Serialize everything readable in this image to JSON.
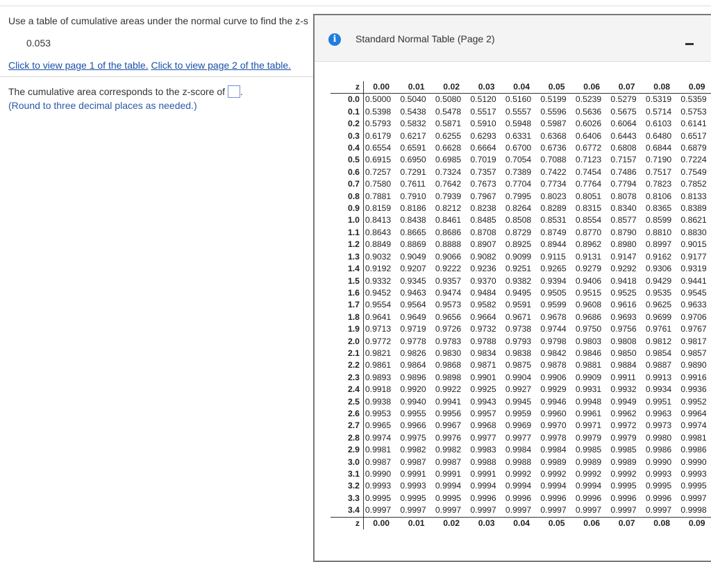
{
  "question": {
    "text": "Use a table of cumulative areas under the normal curve to find the z-s",
    "value": "0.053",
    "link1": "Click to view page 1 of the table.",
    "link2": "Click to view page 2 of the table.",
    "answer_prefix": "The cumulative area corresponds to the z-score of",
    "answer_suffix": ".",
    "hint": "(Round to three decimal places as needed.)"
  },
  "popup": {
    "title": "Standard Normal Table (Page 2)",
    "icon": "info-icon",
    "minimize_icon": "minimize-icon"
  },
  "table": {
    "z_label": "z",
    "columns": [
      "0.00",
      "0.01",
      "0.02",
      "0.03",
      "0.04",
      "0.05",
      "0.06",
      "0.07",
      "0.08",
      "0.09"
    ],
    "rows": [
      {
        "z": "0.0",
        "values": [
          "0.5000",
          "0.5040",
          "0.5080",
          "0.5120",
          "0.5160",
          "0.5199",
          "0.5239",
          "0.5279",
          "0.5319",
          "0.5359"
        ]
      },
      {
        "z": "0.1",
        "values": [
          "0.5398",
          "0.5438",
          "0.5478",
          "0.5517",
          "0.5557",
          "0.5596",
          "0.5636",
          "0.5675",
          "0.5714",
          "0.5753"
        ]
      },
      {
        "z": "0.2",
        "values": [
          "0.5793",
          "0.5832",
          "0.5871",
          "0.5910",
          "0.5948",
          "0.5987",
          "0.6026",
          "0.6064",
          "0.6103",
          "0.6141"
        ]
      },
      {
        "z": "0.3",
        "values": [
          "0.6179",
          "0.6217",
          "0.6255",
          "0.6293",
          "0.6331",
          "0.6368",
          "0.6406",
          "0.6443",
          "0.6480",
          "0.6517"
        ]
      },
      {
        "z": "0.4",
        "values": [
          "0.6554",
          "0.6591",
          "0.6628",
          "0.6664",
          "0.6700",
          "0.6736",
          "0.6772",
          "0.6808",
          "0.6844",
          "0.6879"
        ]
      },
      {
        "z": "0.5",
        "values": [
          "0.6915",
          "0.6950",
          "0.6985",
          "0.7019",
          "0.7054",
          "0.7088",
          "0.7123",
          "0.7157",
          "0.7190",
          "0.7224"
        ]
      },
      {
        "z": "0.6",
        "values": [
          "0.7257",
          "0.7291",
          "0.7324",
          "0.7357",
          "0.7389",
          "0.7422",
          "0.7454",
          "0.7486",
          "0.7517",
          "0.7549"
        ]
      },
      {
        "z": "0.7",
        "values": [
          "0.7580",
          "0.7611",
          "0.7642",
          "0.7673",
          "0.7704",
          "0.7734",
          "0.7764",
          "0.7794",
          "0.7823",
          "0.7852"
        ]
      },
      {
        "z": "0.8",
        "values": [
          "0.7881",
          "0.7910",
          "0.7939",
          "0.7967",
          "0.7995",
          "0.8023",
          "0.8051",
          "0.8078",
          "0.8106",
          "0.8133"
        ]
      },
      {
        "z": "0.9",
        "values": [
          "0.8159",
          "0.8186",
          "0.8212",
          "0.8238",
          "0.8264",
          "0.8289",
          "0.8315",
          "0.8340",
          "0.8365",
          "0.8389"
        ]
      },
      {
        "z": "1.0",
        "values": [
          "0.8413",
          "0.8438",
          "0.8461",
          "0.8485",
          "0.8508",
          "0.8531",
          "0.8554",
          "0.8577",
          "0.8599",
          "0.8621"
        ]
      },
      {
        "z": "1.1",
        "values": [
          "0.8643",
          "0.8665",
          "0.8686",
          "0.8708",
          "0.8729",
          "0.8749",
          "0.8770",
          "0.8790",
          "0.8810",
          "0.8830"
        ]
      },
      {
        "z": "1.2",
        "values": [
          "0.8849",
          "0.8869",
          "0.8888",
          "0.8907",
          "0.8925",
          "0.8944",
          "0.8962",
          "0.8980",
          "0.8997",
          "0.9015"
        ]
      },
      {
        "z": "1.3",
        "values": [
          "0.9032",
          "0.9049",
          "0.9066",
          "0.9082",
          "0.9099",
          "0.9115",
          "0.9131",
          "0.9147",
          "0.9162",
          "0.9177"
        ]
      },
      {
        "z": "1.4",
        "values": [
          "0.9192",
          "0.9207",
          "0.9222",
          "0.9236",
          "0.9251",
          "0.9265",
          "0.9279",
          "0.9292",
          "0.9306",
          "0.9319"
        ]
      },
      {
        "z": "1.5",
        "values": [
          "0.9332",
          "0.9345",
          "0.9357",
          "0.9370",
          "0.9382",
          "0.9394",
          "0.9406",
          "0.9418",
          "0.9429",
          "0.9441"
        ]
      },
      {
        "z": "1.6",
        "values": [
          "0.9452",
          "0.9463",
          "0.9474",
          "0.9484",
          "0.9495",
          "0.9505",
          "0.9515",
          "0.9525",
          "0.9535",
          "0.9545"
        ]
      },
      {
        "z": "1.7",
        "values": [
          "0.9554",
          "0.9564",
          "0.9573",
          "0.9582",
          "0.9591",
          "0.9599",
          "0.9608",
          "0.9616",
          "0.9625",
          "0.9633"
        ]
      },
      {
        "z": "1.8",
        "values": [
          "0.9641",
          "0.9649",
          "0.9656",
          "0.9664",
          "0.9671",
          "0.9678",
          "0.9686",
          "0.9693",
          "0.9699",
          "0.9706"
        ]
      },
      {
        "z": "1.9",
        "values": [
          "0.9713",
          "0.9719",
          "0.9726",
          "0.9732",
          "0.9738",
          "0.9744",
          "0.9750",
          "0.9756",
          "0.9761",
          "0.9767"
        ]
      },
      {
        "z": "2.0",
        "values": [
          "0.9772",
          "0.9778",
          "0.9783",
          "0.9788",
          "0.9793",
          "0.9798",
          "0.9803",
          "0.9808",
          "0.9812",
          "0.9817"
        ]
      },
      {
        "z": "2.1",
        "values": [
          "0.9821",
          "0.9826",
          "0.9830",
          "0.9834",
          "0.9838",
          "0.9842",
          "0.9846",
          "0.9850",
          "0.9854",
          "0.9857"
        ]
      },
      {
        "z": "2.2",
        "values": [
          "0.9861",
          "0.9864",
          "0.9868",
          "0.9871",
          "0.9875",
          "0.9878",
          "0.9881",
          "0.9884",
          "0.9887",
          "0.9890"
        ]
      },
      {
        "z": "2.3",
        "values": [
          "0.9893",
          "0.9896",
          "0.9898",
          "0.9901",
          "0.9904",
          "0.9906",
          "0.9909",
          "0.9911",
          "0.9913",
          "0.9916"
        ]
      },
      {
        "z": "2.4",
        "values": [
          "0.9918",
          "0.9920",
          "0.9922",
          "0.9925",
          "0.9927",
          "0.9929",
          "0.9931",
          "0.9932",
          "0.9934",
          "0.9936"
        ]
      },
      {
        "z": "2.5",
        "values": [
          "0.9938",
          "0.9940",
          "0.9941",
          "0.9943",
          "0.9945",
          "0.9946",
          "0.9948",
          "0.9949",
          "0.9951",
          "0.9952"
        ]
      },
      {
        "z": "2.6",
        "values": [
          "0.9953",
          "0.9955",
          "0.9956",
          "0.9957",
          "0.9959",
          "0.9960",
          "0.9961",
          "0.9962",
          "0.9963",
          "0.9964"
        ]
      },
      {
        "z": "2.7",
        "values": [
          "0.9965",
          "0.9966",
          "0.9967",
          "0.9968",
          "0.9969",
          "0.9970",
          "0.9971",
          "0.9972",
          "0.9973",
          "0.9974"
        ]
      },
      {
        "z": "2.8",
        "values": [
          "0.9974",
          "0.9975",
          "0.9976",
          "0.9977",
          "0.9977",
          "0.9978",
          "0.9979",
          "0.9979",
          "0.9980",
          "0.9981"
        ]
      },
      {
        "z": "2.9",
        "values": [
          "0.9981",
          "0.9982",
          "0.9982",
          "0.9983",
          "0.9984",
          "0.9984",
          "0.9985",
          "0.9985",
          "0.9986",
          "0.9986"
        ]
      },
      {
        "z": "3.0",
        "values": [
          "0.9987",
          "0.9987",
          "0.9987",
          "0.9988",
          "0.9988",
          "0.9989",
          "0.9989",
          "0.9989",
          "0.9990",
          "0.9990"
        ]
      },
      {
        "z": "3.1",
        "values": [
          "0.9990",
          "0.9991",
          "0.9991",
          "0.9991",
          "0.9992",
          "0.9992",
          "0.9992",
          "0.9992",
          "0.9993",
          "0.9993"
        ]
      },
      {
        "z": "3.2",
        "values": [
          "0.9993",
          "0.9993",
          "0.9994",
          "0.9994",
          "0.9994",
          "0.9994",
          "0.9994",
          "0.9995",
          "0.9995",
          "0.9995"
        ]
      },
      {
        "z": "3.3",
        "values": [
          "0.9995",
          "0.9995",
          "0.9995",
          "0.9996",
          "0.9996",
          "0.9996",
          "0.9996",
          "0.9996",
          "0.9996",
          "0.9997"
        ]
      },
      {
        "z": "3.4",
        "values": [
          "0.9997",
          "0.9997",
          "0.9997",
          "0.9997",
          "0.9997",
          "0.9997",
          "0.9997",
          "0.9997",
          "0.9997",
          "0.9998"
        ]
      }
    ]
  }
}
